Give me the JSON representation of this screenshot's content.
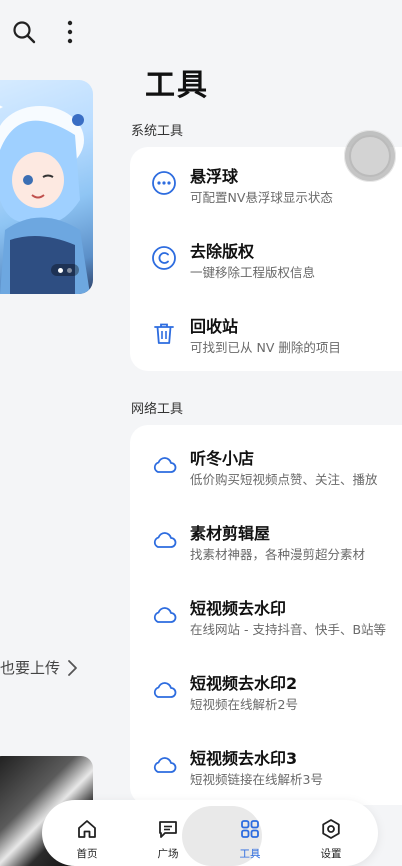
{
  "left_pane": {
    "upload_text": "也要上传",
    "top_icons": [
      "search-icon",
      "more-vertical-icon"
    ]
  },
  "page": {
    "title": "工具"
  },
  "sections": {
    "system": {
      "label": "系统工具",
      "items": [
        {
          "title": "悬浮球",
          "desc": "可配置NV悬浮球显示状态",
          "icon": "more-horizontal-icon"
        },
        {
          "title": "去除版权",
          "desc": "一键移除工程版权信息",
          "icon": "copyright-icon"
        },
        {
          "title": "回收站",
          "desc": "可找到已从 NV 删除的项目",
          "icon": "trash-icon"
        }
      ]
    },
    "network": {
      "label": "网络工具",
      "items": [
        {
          "title": "听冬小店",
          "desc": "低价购买短视频点赞、关注、播放",
          "icon": "cloud-icon"
        },
        {
          "title": "素材剪辑屋",
          "desc": "找素材神器，各种漫剪超分素材",
          "icon": "cloud-icon"
        },
        {
          "title": "短视频去水印",
          "desc": "在线网站 - 支持抖音、快手、B站等",
          "icon": "cloud-icon"
        },
        {
          "title": "短视频去水印2",
          "desc": "短视频在线解析2号",
          "icon": "cloud-icon"
        },
        {
          "title": "短视频去水印3",
          "desc": "短视频链接在线解析3号",
          "icon": "cloud-icon"
        }
      ]
    }
  },
  "nav": {
    "items": [
      {
        "label": "首页",
        "icon": "home-icon"
      },
      {
        "label": "广场",
        "icon": "message-square-icon"
      },
      {
        "label": "工具",
        "icon": "grid-icon",
        "active": true
      },
      {
        "label": "设置",
        "icon": "settings-icon"
      }
    ]
  },
  "colors": {
    "accent": "#2d6cdf",
    "background": "#f4f5f7",
    "card": "#ffffff"
  }
}
